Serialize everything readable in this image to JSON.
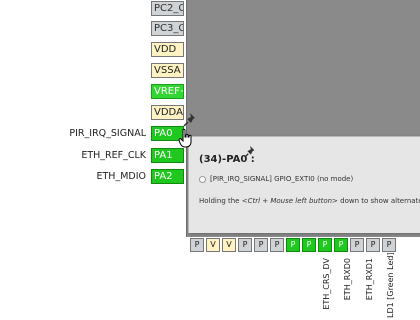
{
  "chip": {
    "pins_left": [
      {
        "label": "PC2_C",
        "style": "gray"
      },
      {
        "label": "PC3_C",
        "style": "gray"
      },
      {
        "label": "VDD",
        "style": "yellow"
      },
      {
        "label": "VSSA",
        "style": "yellow"
      },
      {
        "label": "VREF+",
        "style": "lgreen"
      },
      {
        "label": "VDDA",
        "style": "yellow"
      },
      {
        "label": "PA0",
        "style": "green",
        "signal": "PIR_IRQ_SIGNAL"
      },
      {
        "label": "PA1",
        "style": "green",
        "signal": "ETH_REF_CLK"
      },
      {
        "label": "PA2",
        "style": "green",
        "signal": "ETH_MDIO"
      }
    ],
    "pins_bottom": [
      {
        "label": "P",
        "style": "gray"
      },
      {
        "label": "V",
        "style": "yellow"
      },
      {
        "label": "V",
        "style": "yellow"
      },
      {
        "label": "P",
        "style": "gray"
      },
      {
        "label": "P",
        "style": "gray"
      },
      {
        "label": "P",
        "style": "gray"
      },
      {
        "label": "P",
        "style": "green"
      },
      {
        "label": "P",
        "style": "green"
      },
      {
        "label": "P",
        "style": "green"
      },
      {
        "label": "P",
        "style": "green"
      },
      {
        "label": "P",
        "style": "gray"
      },
      {
        "label": "P",
        "style": "gray"
      },
      {
        "label": "P",
        "style": "gray"
      }
    ],
    "bottom_signals": [
      "ETH_CRS_DV",
      "ETH_RXD0",
      "ETH_RXD1",
      "LD1 [Green Led]"
    ]
  },
  "tooltip": {
    "title": "(34)-PA0 :",
    "mode_line": "[PIR_IRQ_SIGNAL] GPIO_EXTI0 (no mode)",
    "hint_prefix": "Holding the ",
    "hint_keys": "<Ctrl + Mouse left button>",
    "hint_suffix": " down to show alternate p"
  },
  "icons": [
    "pushpin-icon",
    "pushpin-icon",
    "hand-cursor-icon"
  ],
  "colors": {
    "pin_green": "#1ec81e",
    "pin_yellow": "#fff3c4",
    "pin_gray": "#cfd3d6",
    "chip_body": "#8a8a8a",
    "tooltip_bg": "#e6e6e6"
  }
}
